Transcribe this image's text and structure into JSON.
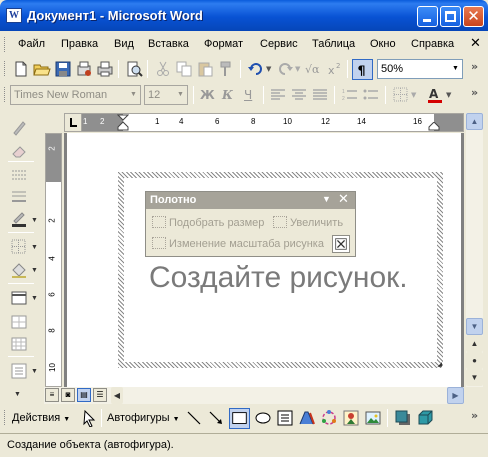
{
  "window": {
    "title": "Документ1 - Microsoft Word",
    "app_icon_letter": "W"
  },
  "menu": {
    "items": [
      "Файл",
      "Правка",
      "Вид",
      "Вставка",
      "Формат",
      "Сервис",
      "Таблица",
      "Окно",
      "Справка"
    ],
    "close_glyph": "✕"
  },
  "standard_toolbar": {
    "icons": [
      "new-icon",
      "open-icon",
      "save-icon",
      "print-icon",
      "permission-icon",
      "print-preview-icon",
      "cut-icon",
      "copy-icon",
      "paste-icon",
      "format-painter-icon",
      "undo-icon",
      "redo-icon",
      "equation-icon",
      "superscript-icon",
      "show-formatting-icon"
    ],
    "zoom": "50%"
  },
  "formatting_toolbar": {
    "font": "Times New Roman",
    "size": "12",
    "bold": "Ж",
    "italic": "К",
    "underline": "Ч"
  },
  "ruler": {
    "h_labels": [
      "1",
      "2",
      "1",
      "1",
      "4",
      "6",
      "8",
      "10",
      "12",
      "14",
      "16"
    ],
    "v_labels": [
      "2",
      "2",
      "4",
      "6",
      "8",
      "10"
    ]
  },
  "canvas": {
    "prompt": "Создайте рисунок."
  },
  "canvas_toolbar": {
    "title": "Полотно",
    "fit_label": "Подобрать размер",
    "expand_label": "Увеличить",
    "scale_label": "Изменение масштаба рисунка"
  },
  "draw_toolbar": {
    "actions_label": "Действия",
    "autoshapes_label": "Автофигуры"
  },
  "status": {
    "text": "Создание объекта (автофигура)."
  },
  "colors": {
    "title_bar": "#0852d4",
    "font_color_underline": "#d40000"
  }
}
